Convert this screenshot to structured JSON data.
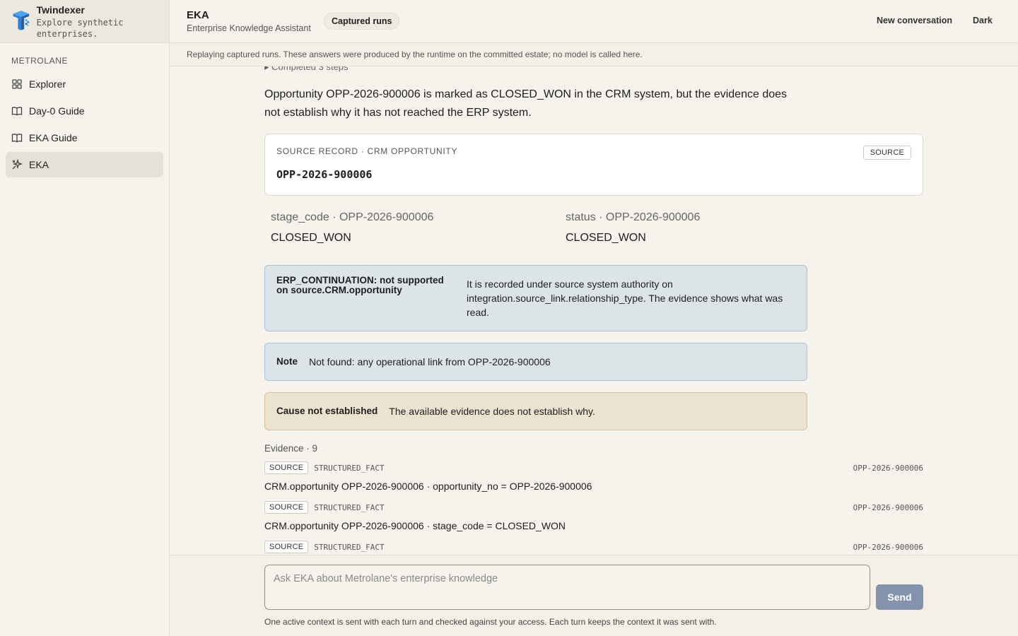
{
  "brand": {
    "name": "Twindexer",
    "tagline": "Explore synthetic enterprises."
  },
  "sidebar": {
    "org": "METROLANE",
    "items": [
      {
        "label": "Explorer",
        "icon": "grid-icon",
        "active": false
      },
      {
        "label": "Day-0 Guide",
        "icon": "book-icon",
        "active": false
      },
      {
        "label": "EKA Guide",
        "icon": "book-icon",
        "active": false
      },
      {
        "label": "EKA",
        "icon": "sparkle-icon",
        "active": true
      }
    ]
  },
  "header": {
    "title": "EKA",
    "subtitle": "Enterprise Knowledge Assistant",
    "badge": "Captured runs",
    "new_conversation": "New conversation",
    "theme_toggle": "Dark"
  },
  "banner": "Replaying captured runs. These answers were produced by the runtime on the committed estate; no model is called here.",
  "message": {
    "steps": "▸ Completed 3 steps",
    "answer": "Opportunity OPP-2026-900006 is marked as CLOSED_WON in the CRM system, but the evidence does not establish why it has not reached the ERP system.",
    "source_card": {
      "kicker": "SOURCE RECORD · CRM OPPORTUNITY",
      "id": "OPP-2026-900006",
      "tag": "SOURCE"
    },
    "fields": [
      {
        "label": "stage_code · OPP-2026-900006",
        "value": "CLOSED_WON"
      },
      {
        "label": "status · OPP-2026-900006",
        "value": "CLOSED_WON"
      }
    ],
    "callouts": [
      {
        "key": "ERP_CONTINUATION: not supported on source.CRM.opportunity",
        "text": "It is recorded under source system authority on integration.source_link.relationship_type. The evidence shows what was read."
      },
      {
        "key": "Note",
        "text": "Not found: any operational link from OPP-2026-900006"
      },
      {
        "key": "Cause not established",
        "text": "The available evidence does not establish why."
      }
    ],
    "evidence_heading": "Evidence · 9",
    "evidence": [
      {
        "tag": "SOURCE",
        "type": "STRUCTURED_FACT",
        "ref": "OPP-2026-900006",
        "text": "CRM.opportunity OPP-2026-900006 · opportunity_no = OPP-2026-900006"
      },
      {
        "tag": "SOURCE",
        "type": "STRUCTURED_FACT",
        "ref": "OPP-2026-900006",
        "text": "CRM.opportunity OPP-2026-900006 · stage_code = CLOSED_WON"
      },
      {
        "tag": "SOURCE",
        "type": "STRUCTURED_FACT",
        "ref": "OPP-2026-900006",
        "text": ""
      }
    ]
  },
  "composer": {
    "placeholder": "Ask EKA about Metrolane's enterprise knowledge",
    "send": "Send",
    "footnote": "One active context is sent with each turn and checked against your access. Each turn keeps the context it was sent with."
  },
  "colors": {
    "accent": "#8393ae",
    "info_bg": "#dde4e8",
    "warn_bg": "#ece2d0",
    "logo_blue": "#2b7fd9"
  }
}
